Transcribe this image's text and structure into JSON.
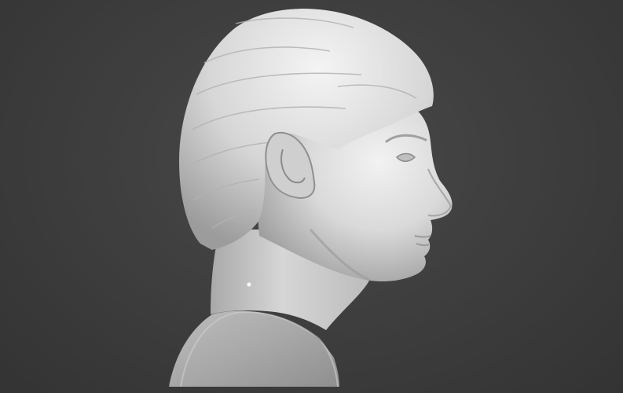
{
  "scene": {
    "subject": "bust-sculpture",
    "view": "right-profile",
    "background_color": "#3c3c3c",
    "material_color": "#d8d8d8"
  }
}
